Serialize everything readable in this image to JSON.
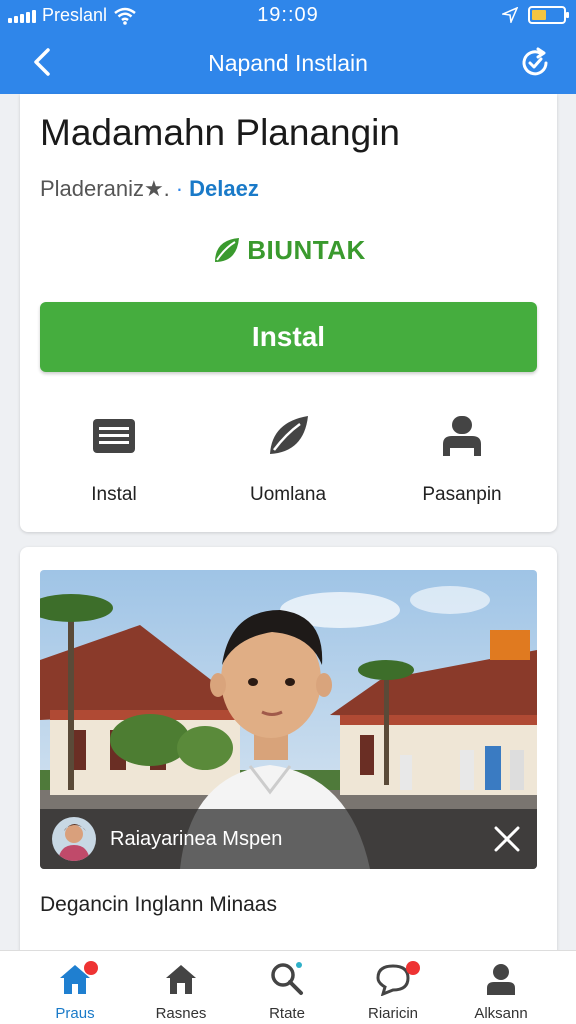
{
  "status_bar": {
    "carrier": "Preslanl",
    "time": "19::09"
  },
  "nav": {
    "title": "Napand Instlain"
  },
  "app": {
    "title": "Madamahn Planangin",
    "developer": "Pladeraniz★.",
    "developer_link": "Delaez",
    "brand_name": "BIUNTAK",
    "install_label": "Instal",
    "actions": [
      {
        "label": "Instal",
        "icon": "keyboard-icon"
      },
      {
        "label": "Uomlana",
        "icon": "leaf-icon"
      },
      {
        "label": "Pasanpin",
        "icon": "person-icon"
      }
    ]
  },
  "media": {
    "caption": "Raiayarinea Mspen",
    "description": "Degancin Inglann Minaas"
  },
  "bottom_nav": [
    {
      "label": "Praus",
      "icon": "home-icon",
      "active": true
    },
    {
      "label": "Rasnes",
      "icon": "store-icon",
      "active": false
    },
    {
      "label": "Rtate",
      "icon": "search-icon",
      "active": false
    },
    {
      "label": "Riaricin",
      "icon": "chat-icon",
      "active": false
    },
    {
      "label": "Alksann",
      "icon": "profile-icon",
      "active": false
    }
  ],
  "colors": {
    "header": "#2f86ea",
    "install": "#45ad3e",
    "link": "#1a7ac8",
    "active_tab": "#1a7ac8",
    "badge": "#ee3333"
  }
}
